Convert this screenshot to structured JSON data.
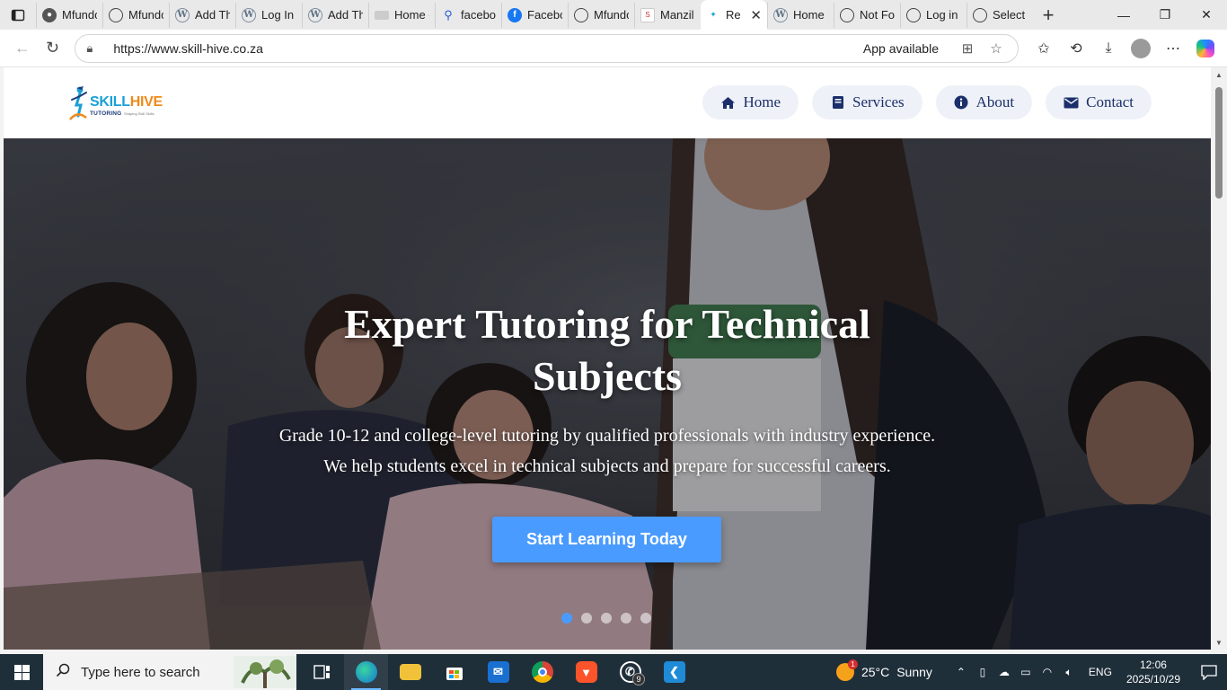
{
  "browser": {
    "tabs": [
      {
        "label": "Mfundo",
        "icon": "github-icon"
      },
      {
        "label": "Mfundo",
        "icon": "globe-icon"
      },
      {
        "label": "Add Th",
        "icon": "wordpress-icon"
      },
      {
        "label": "Log In",
        "icon": "wordpress-icon"
      },
      {
        "label": "Add Th",
        "icon": "wordpress-icon"
      },
      {
        "label": "Home -",
        "icon": "page-icon"
      },
      {
        "label": "facebo",
        "icon": "search-icon"
      },
      {
        "label": "Facebo",
        "icon": "facebook-icon"
      },
      {
        "label": "Mfundo",
        "icon": "globe-icon"
      },
      {
        "label": "Manzil",
        "icon": "manzil-icon"
      },
      {
        "label": "Re",
        "icon": "skillhive-icon",
        "active": true
      },
      {
        "label": "Home",
        "icon": "wordpress-icon"
      },
      {
        "label": "Not Fo",
        "icon": "globe-icon"
      },
      {
        "label": "Log in",
        "icon": "globe-icon"
      },
      {
        "label": "Select c",
        "icon": "globe-icon"
      }
    ],
    "url": "https://www.skill-hive.co.za",
    "app_available": "App available"
  },
  "site": {
    "logo": {
      "skill": "SKILL",
      "hive": "HIVE",
      "tutoring": "TUTORING",
      "tagline": "Shaping Skill Skills"
    },
    "nav": [
      {
        "label": "Home",
        "icon": "home-icon"
      },
      {
        "label": "Services",
        "icon": "book-icon"
      },
      {
        "label": "About",
        "icon": "info-icon"
      },
      {
        "label": "Contact",
        "icon": "envelope-icon"
      }
    ],
    "hero": {
      "title": "Expert Tutoring for Technical Subjects",
      "subtitle_line1": "Grade 10-12 and college-level tutoring by qualified professionals with industry experience.",
      "subtitle_line2": "We help students excel in technical subjects and prepare for successful careers.",
      "cta": "Start Learning Today",
      "slide_count": 5,
      "active_slide": 1
    }
  },
  "taskbar": {
    "search_placeholder": "Type here to search",
    "apps": [
      {
        "name": "task-view",
        "label": ""
      },
      {
        "name": "edge",
        "label": ""
      },
      {
        "name": "file-explorer",
        "label": ""
      },
      {
        "name": "microsoft-store",
        "label": ""
      },
      {
        "name": "outlook",
        "label": ""
      },
      {
        "name": "chrome",
        "label": ""
      },
      {
        "name": "brave",
        "label": ""
      },
      {
        "name": "whatsapp",
        "label": "",
        "badge": "9"
      },
      {
        "name": "vscode",
        "label": ""
      }
    ],
    "weather": {
      "temp": "25°C",
      "condition": "Sunny",
      "badge": "1"
    },
    "language": "ENG",
    "time": "12:06",
    "date": "2025/10/29"
  },
  "colors": {
    "accent": "#4a9bff",
    "nav_text": "#1b2f6b",
    "nav_pill_bg": "#eef1f7",
    "logo_blue": "#1aa0d6",
    "logo_orange": "#f08a1c"
  }
}
